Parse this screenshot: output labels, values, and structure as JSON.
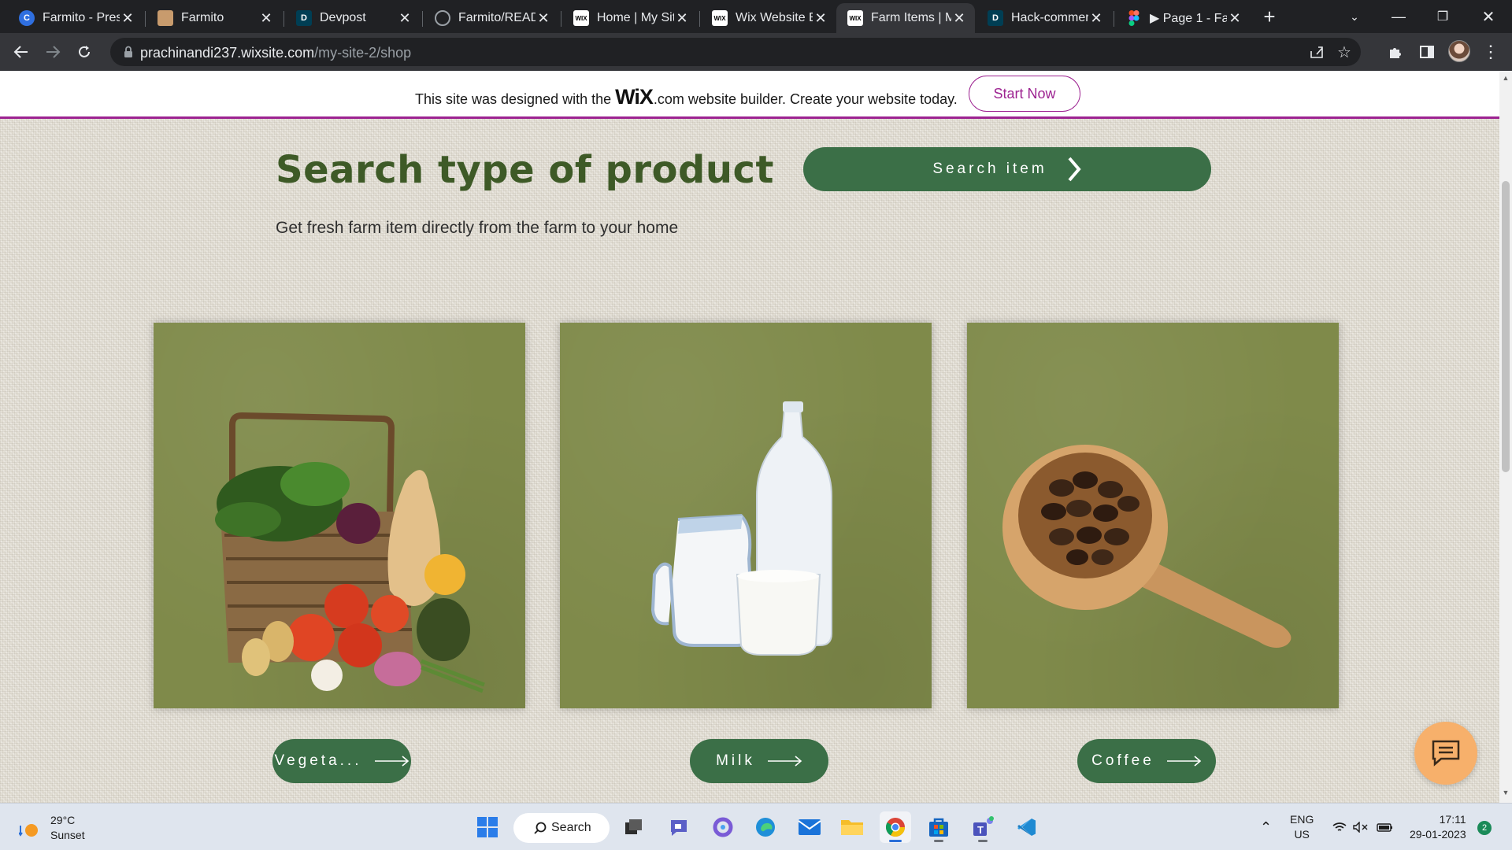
{
  "browser": {
    "tabs": [
      {
        "title": "Farmito - Pres",
        "favicon": "canva-icon",
        "color": "#2f6fe0"
      },
      {
        "title": "Farmito",
        "favicon": "farm-image-icon",
        "color": "#c89b6d"
      },
      {
        "title": "Devpost",
        "favicon": "devpost-icon",
        "color": "#003e54"
      },
      {
        "title": "Farmito/READ",
        "favicon": "github-icon",
        "color": "#202124"
      },
      {
        "title": "Home | My Sit",
        "favicon": "wix-icon",
        "color": "#ffffff"
      },
      {
        "title": "Wix Website E",
        "favicon": "wix-icon",
        "color": "#ffffff"
      },
      {
        "title": "Farm Items | M",
        "favicon": "wix-icon",
        "color": "#ffffff"
      },
      {
        "title": "Hack-commer",
        "favicon": "devpost-icon",
        "color": "#003e54"
      },
      {
        "title": "▶ Page 1 - Fa",
        "favicon": "figma-icon",
        "color": "#f24e1e"
      }
    ],
    "active_tab_index": 6,
    "url_host": "prachinandi237.wixsite.com",
    "url_path": "/my-site-2/shop"
  },
  "wix_banner": {
    "prefix": "This site was designed with the",
    "logo": "WiX",
    "logo_suffix": ".com",
    "suffix": "website builder. Create your website today.",
    "cta": "Start Now"
  },
  "page": {
    "headline": "Search type of product",
    "search_button": "Search item",
    "subline": "Get fresh farm item directly from the farm to your home",
    "categories": [
      {
        "label": "Vegeta...",
        "image": "vegetable-basket"
      },
      {
        "label": "Milk",
        "image": "milk-bottles"
      },
      {
        "label": "Coffee",
        "image": "coffee-beans-scoop"
      }
    ]
  },
  "taskbar": {
    "weather_temp": "29°C",
    "weather_desc": "Sunset",
    "search_label": "Search",
    "lang_top": "ENG",
    "lang_bottom": "US",
    "time": "17:11",
    "date": "29-01-2023",
    "notifications": "2"
  },
  "colors": {
    "brand_green": "#3b6f47",
    "headline_green": "#3e5a27",
    "card_olive": "#7f8a4a",
    "wix_purple": "#9d2391",
    "chat_orange": "#f7b06b"
  }
}
